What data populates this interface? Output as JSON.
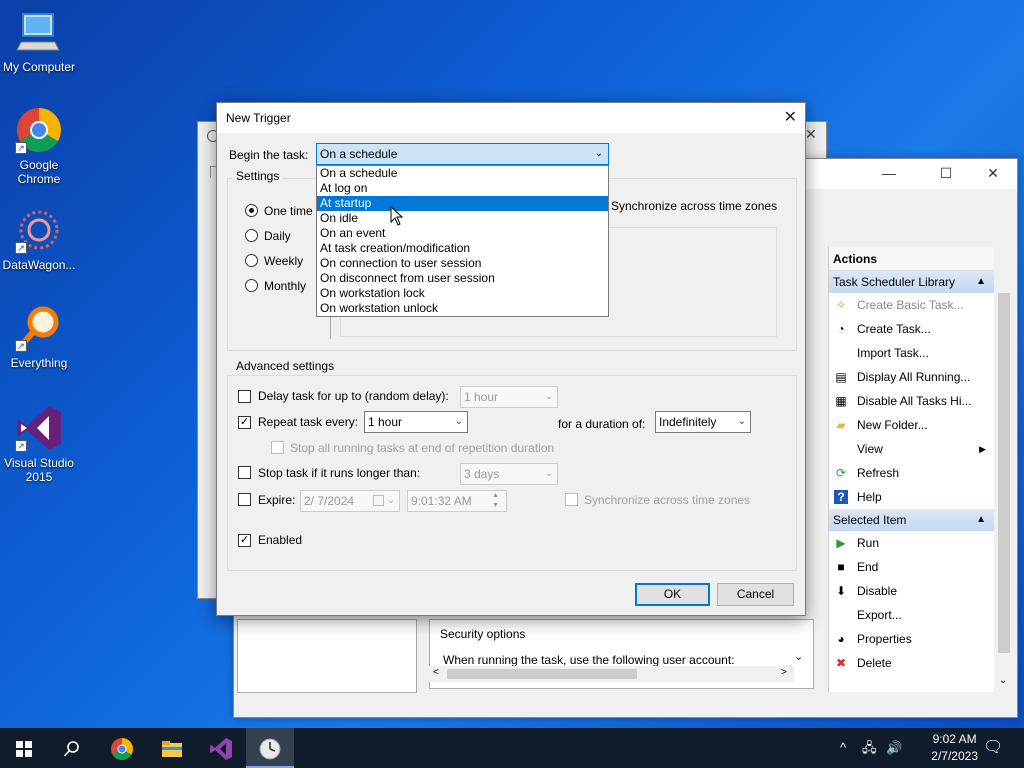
{
  "desktop": {
    "icons": [
      {
        "label": "My Computer"
      },
      {
        "label": "Google\nChrome"
      },
      {
        "label": "DataWagon..."
      },
      {
        "label": "Everything"
      },
      {
        "label": "Visual Studio\n2015"
      }
    ]
  },
  "main_window": {
    "actions_header": "Actions",
    "section_library": "Task Scheduler Library",
    "library_items": [
      {
        "label": "Create Basic Task...",
        "icon": "wizard-icon",
        "disabled": true
      },
      {
        "label": "Create Task...",
        "icon": "task-icon"
      },
      {
        "label": "Import Task...",
        "icon": ""
      },
      {
        "label": "Display All Running...",
        "icon": "list-icon"
      },
      {
        "label": "Disable All Tasks Hi...",
        "icon": "history-icon"
      },
      {
        "label": "New Folder...",
        "icon": "folder-icon"
      },
      {
        "label": "View",
        "icon": "",
        "submenu": true
      },
      {
        "label": "Refresh",
        "icon": "refresh-icon"
      },
      {
        "label": "Help",
        "icon": "help-icon"
      }
    ],
    "section_selected": "Selected Item",
    "selected_items": [
      {
        "label": "Run",
        "icon": "run-icon"
      },
      {
        "label": "End",
        "icon": "stop-icon"
      },
      {
        "label": "Disable",
        "icon": "disable-icon"
      },
      {
        "label": "Export...",
        "icon": ""
      },
      {
        "label": "Properties",
        "icon": "properties-icon"
      },
      {
        "label": "Delete",
        "icon": "delete-icon"
      }
    ],
    "security_options": "Security options",
    "security_text": "When running the task, use the following user account:"
  },
  "dialog": {
    "title": "New Trigger",
    "begin_label": "Begin the task:",
    "begin_value": "On a schedule",
    "options": [
      "On a schedule",
      "At log on",
      "At startup",
      "On idle",
      "On an event",
      "At task creation/modification",
      "On connection to user session",
      "On disconnect from user session",
      "On workstation lock",
      "On workstation unlock"
    ],
    "highlighted_option": "At startup",
    "settings_label": "Settings",
    "schedule_radios": [
      "One time",
      "Daily",
      "Weekly",
      "Monthly"
    ],
    "sync_label": "Synchronize across time zones",
    "advanced_label": "Advanced settings",
    "delay_label": "Delay task for up to (random delay):",
    "delay_value": "1 hour",
    "repeat_label": "Repeat task every:",
    "repeat_value": "1 hour",
    "duration_label": "for a duration of:",
    "duration_value": "Indefinitely",
    "stop_running_label": "Stop all running tasks at end of repetition duration",
    "stop_longer_label": "Stop task if it runs longer than:",
    "stop_longer_value": "3 days",
    "expire_label": "Expire:",
    "expire_date": "2/  7/2024",
    "expire_time": "9:01:32 AM",
    "expire_sync_label": "Synchronize across time zones",
    "enabled_label": "Enabled",
    "ok_label": "OK",
    "cancel_label": "Cancel"
  },
  "taskbar": {
    "time": "9:02 AM",
    "date": "2/7/2023"
  },
  "colors": {
    "accent": "#0078d7",
    "desktop": "#0d5fd4",
    "taskbar": "#101c2c"
  }
}
